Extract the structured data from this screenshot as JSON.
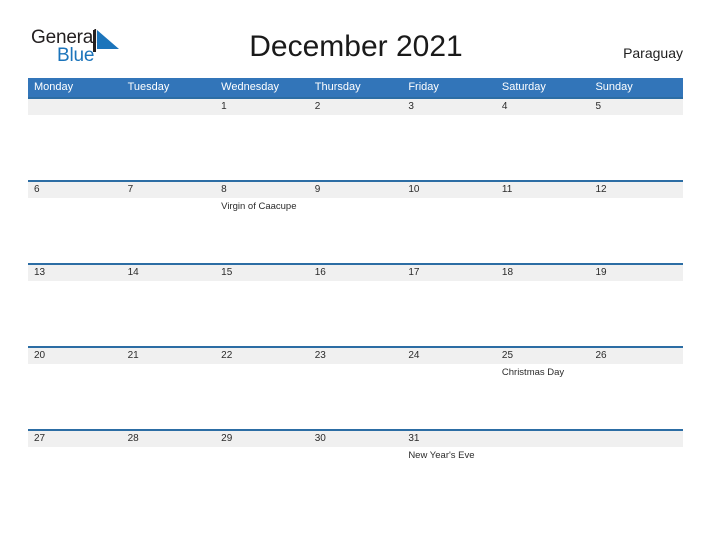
{
  "brand": {
    "name_part1": "General",
    "name_part2": "Blue",
    "mark_icon": "blue-triangle-icon"
  },
  "header": {
    "title": "December 2021",
    "region": "Paraguay"
  },
  "colors": {
    "header_blue": "#3275b9",
    "separator_blue": "#2c6da4",
    "date_strip_gray": "#f0f0f0",
    "brand_blue": "#1b74bb"
  },
  "calendar": {
    "weekdays": [
      "Monday",
      "Tuesday",
      "Wednesday",
      "Thursday",
      "Friday",
      "Saturday",
      "Sunday"
    ],
    "weeks": [
      {
        "days": [
          {
            "date": "",
            "event": ""
          },
          {
            "date": "",
            "event": ""
          },
          {
            "date": "1",
            "event": ""
          },
          {
            "date": "2",
            "event": ""
          },
          {
            "date": "3",
            "event": ""
          },
          {
            "date": "4",
            "event": ""
          },
          {
            "date": "5",
            "event": ""
          }
        ]
      },
      {
        "days": [
          {
            "date": "6",
            "event": ""
          },
          {
            "date": "7",
            "event": ""
          },
          {
            "date": "8",
            "event": "Virgin of Caacupe"
          },
          {
            "date": "9",
            "event": ""
          },
          {
            "date": "10",
            "event": ""
          },
          {
            "date": "11",
            "event": ""
          },
          {
            "date": "12",
            "event": ""
          }
        ]
      },
      {
        "days": [
          {
            "date": "13",
            "event": ""
          },
          {
            "date": "14",
            "event": ""
          },
          {
            "date": "15",
            "event": ""
          },
          {
            "date": "16",
            "event": ""
          },
          {
            "date": "17",
            "event": ""
          },
          {
            "date": "18",
            "event": ""
          },
          {
            "date": "19",
            "event": ""
          }
        ]
      },
      {
        "days": [
          {
            "date": "20",
            "event": ""
          },
          {
            "date": "21",
            "event": ""
          },
          {
            "date": "22",
            "event": ""
          },
          {
            "date": "23",
            "event": ""
          },
          {
            "date": "24",
            "event": ""
          },
          {
            "date": "25",
            "event": "Christmas Day"
          },
          {
            "date": "26",
            "event": ""
          }
        ]
      },
      {
        "days": [
          {
            "date": "27",
            "event": ""
          },
          {
            "date": "28",
            "event": ""
          },
          {
            "date": "29",
            "event": ""
          },
          {
            "date": "30",
            "event": ""
          },
          {
            "date": "31",
            "event": "New Year's Eve"
          },
          {
            "date": "",
            "event": ""
          },
          {
            "date": "",
            "event": ""
          }
        ]
      }
    ]
  }
}
